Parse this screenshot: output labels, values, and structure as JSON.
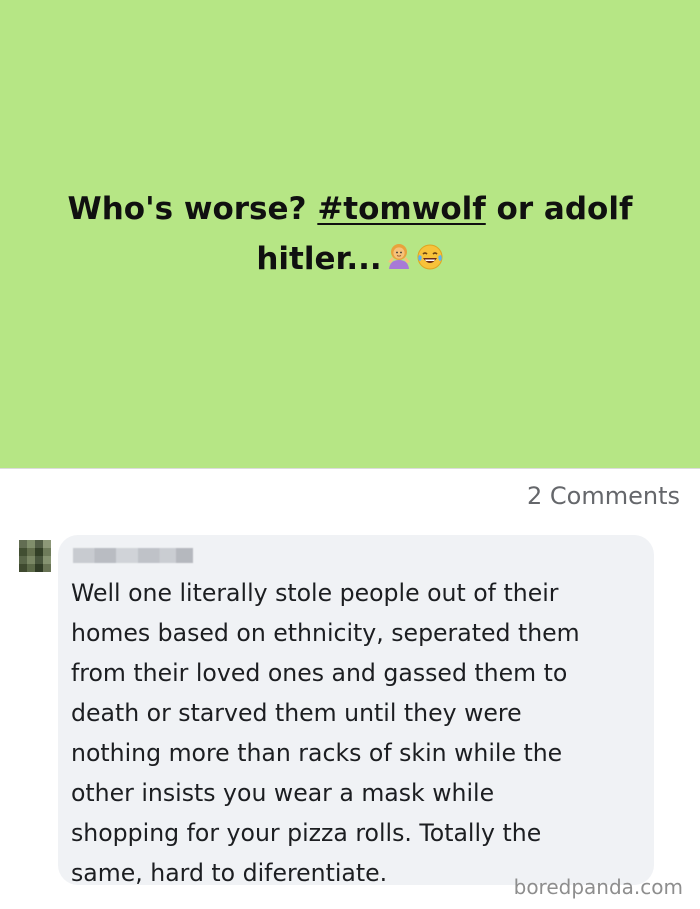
{
  "post": {
    "text_before": "Who's worse? ",
    "hashtag": "#tomwolf",
    "text_after_line1": " or adolf",
    "text_line2": "hitler...",
    "emoji_1": "woman-shrugging-emoji",
    "emoji_2": "face-with-tears-of-joy-emoji",
    "background_color": "#b6e685"
  },
  "comments": {
    "count_label": "2 Comments",
    "items": [
      {
        "author": "",
        "text_lines": [
          "Well one literally stole people out of their",
          "homes based on ethnicity, seperated them",
          "from their loved ones and gassed them to",
          "death or starved them until they were",
          "nothing more than racks of skin while the",
          "other insists you wear a mask while",
          "shopping for your pizza rolls. Totally the",
          "same, hard to diferentiate."
        ]
      }
    ]
  },
  "watermark": "boredpanda.com"
}
